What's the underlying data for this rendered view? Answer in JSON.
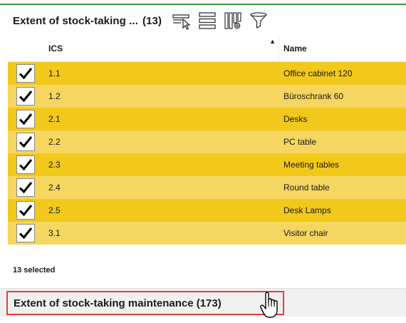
{
  "panel": {
    "title": "Extent of stock-taking ...",
    "count": "(13)"
  },
  "toolbar": {
    "icons": [
      "select-rows-icon",
      "list-view-icon",
      "column-settings-icon",
      "filter-icon"
    ]
  },
  "table": {
    "columns": [
      "ICS",
      "Name"
    ],
    "sort": {
      "column": "ICS",
      "direction": "ascending"
    },
    "rows": [
      {
        "ics": "1.1",
        "name": "Office cabinet 120",
        "checked": true
      },
      {
        "ics": "1.2",
        "name": "Büroschrank 60",
        "checked": true
      },
      {
        "ics": "2.1",
        "name": "Desks",
        "checked": true
      },
      {
        "ics": "2.2",
        "name": "PC table",
        "checked": true
      },
      {
        "ics": "2.3",
        "name": "Meeting tables",
        "checked": true
      },
      {
        "ics": "2.4",
        "name": "Round table",
        "checked": true
      },
      {
        "ics": "2.5",
        "name": "Desk Lamps",
        "checked": true
      },
      {
        "ics": "3.1",
        "name": "Visitor chair",
        "checked": true
      }
    ]
  },
  "footer": {
    "selected": "13 selected"
  },
  "panel2": {
    "title": "Extent of stock-taking maintenance (173)"
  },
  "colors": {
    "accent_line": "#3ca33c",
    "row_odd": "#f2c81a",
    "row_even": "#f4d660",
    "highlight_border": "#e24040"
  }
}
